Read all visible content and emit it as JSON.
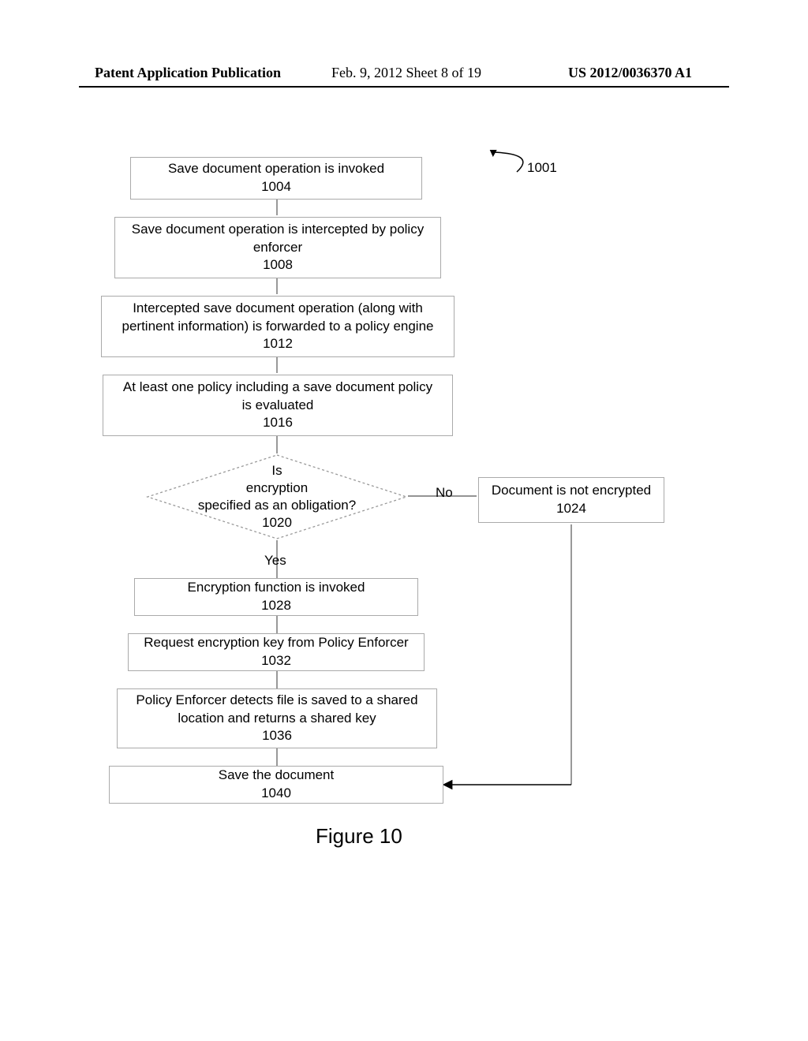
{
  "header": {
    "left": "Patent Application Publication",
    "mid": "Feb. 9, 2012   Sheet 8 of 19",
    "right": "US 2012/0036370 A1"
  },
  "leader_ref": "1001",
  "boxes": {
    "b1004": {
      "line1": "Save document operation is invoked",
      "num": "1004"
    },
    "b1008": {
      "line1": "Save document operation is intercepted by policy",
      "line2": "enforcer",
      "num": "1008"
    },
    "b1012": {
      "line1": "Intercepted save document operation (along with",
      "line2": "pertinent information) is forwarded to a policy engine",
      "num": "1012"
    },
    "b1016": {
      "line1": "At least one policy including a save document policy",
      "line2": "is evaluated",
      "num": "1016"
    },
    "d1020": {
      "line1": "Is",
      "line2": "encryption",
      "line3": "specified as an obligation?",
      "num": "1020"
    },
    "b1024": {
      "line1": "Document is not encrypted",
      "num": "1024"
    },
    "b1028": {
      "line1": "Encryption function is invoked",
      "num": "1028"
    },
    "b1032": {
      "line1": "Request encryption key from Policy Enforcer",
      "num": "1032"
    },
    "b1036": {
      "line1": "Policy Enforcer detects file is saved to a shared",
      "line2": "location and returns a shared key",
      "num": "1036"
    },
    "b1040": {
      "line1": "Save the document",
      "num": "1040"
    }
  },
  "labels": {
    "no": "No",
    "yes": "Yes"
  },
  "caption": "Figure 10"
}
